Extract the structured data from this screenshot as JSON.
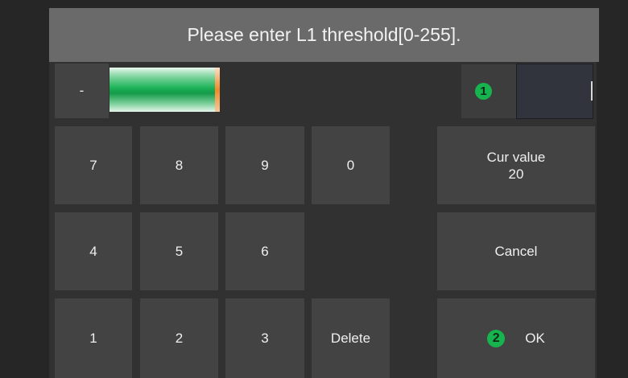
{
  "title": "Please enter L1 threshold[0-255].",
  "minus_label": "-",
  "input": {
    "value": "",
    "progress_fraction": 0.08
  },
  "badges": {
    "first": "1",
    "second": "2"
  },
  "keypad": {
    "k7": "7",
    "k8": "8",
    "k9": "9",
    "k0": "0",
    "k4": "4",
    "k5": "5",
    "k6": "6",
    "k1": "1",
    "k2": "2",
    "k3": "3",
    "delete": "Delete"
  },
  "side": {
    "cur_value_label": "Cur value",
    "cur_value": "20",
    "cancel": "Cancel",
    "ok": "OK"
  },
  "colors": {
    "accent_green": "#17b34f",
    "cursor_orange": "#f08a2a"
  }
}
